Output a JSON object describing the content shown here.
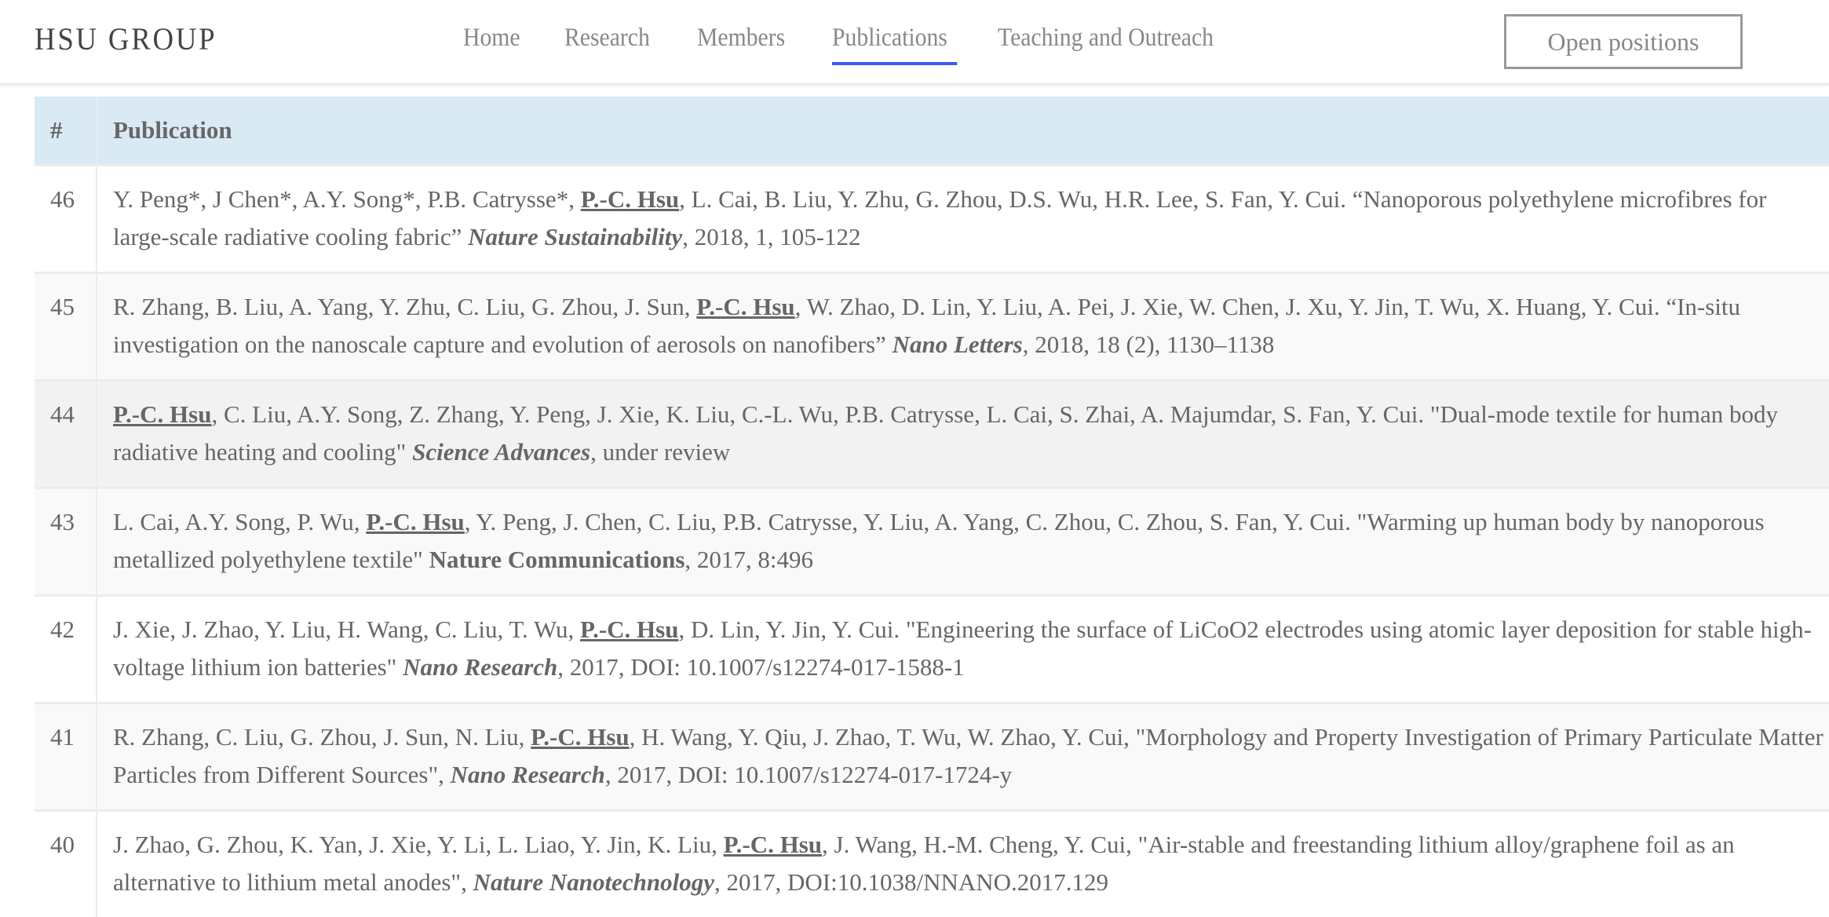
{
  "header": {
    "brand": "HSU GROUP",
    "nav": [
      {
        "label": "Home",
        "active": false
      },
      {
        "label": "Research",
        "active": false
      },
      {
        "label": "Members",
        "active": false
      },
      {
        "label": "Publications",
        "active": true
      },
      {
        "label": "Teaching and Outreach",
        "active": false
      }
    ],
    "open_positions_label": "Open positions",
    "accent_color": "#3b5bf0"
  },
  "table": {
    "columns": [
      "#",
      "Publication"
    ],
    "rows": [
      {
        "num": "46",
        "before": "Y. Peng*, J Chen*, A.Y. Song*, P.B. Catrysse*, ",
        "highlight": "P.-C. Hsu",
        "after": ", L. Cai, B. Liu, Y. Zhu, G. Zhou, D.S. Wu, H.R. Lee, S. Fan, Y. Cui. “Nanoporous polyethylene microfibres for large-scale radiative cooling fabric” ",
        "journal": "Nature Sustainability",
        "journal_italic": true,
        "tail": ", 2018, 1, 105-122"
      },
      {
        "num": "45",
        "before": "R. Zhang, B. Liu, A. Yang, Y. Zhu, C. Liu, G. Zhou, J. Sun, ",
        "highlight": "P.-C. Hsu",
        "after": ", W. Zhao, D. Lin, Y. Liu, A. Pei, J. Xie, W. Chen, J. Xu, Y. Jin, T. Wu, X. Huang, Y. Cui. “In-situ investigation on the nanoscale capture and evolution of aerosols on nanofibers” ",
        "journal": "Nano Letters",
        "journal_italic": true,
        "tail": ", 2018, 18 (2), 1130–1138"
      },
      {
        "num": "44",
        "before": "",
        "highlight": "P.-C. Hsu",
        "after": ", C. Liu, A.Y. Song, Z. Zhang, Y. Peng, J. Xie, K. Liu, C.-L. Wu, P.B. Catrysse, L. Cai, S. Zhai, A. Majumdar, S. Fan, Y. Cui. \"Dual-mode textile for human body radiative heating and cooling\" ",
        "journal": "Science Advances",
        "journal_italic": true,
        "tail": ", under review"
      },
      {
        "num": "43",
        "before": "L. Cai, A.Y. Song, P. Wu, ",
        "highlight": "P.-C. Hsu",
        "after": ", Y. Peng, J. Chen, C. Liu, P.B. Catrysse, Y. Liu, A. Yang, C. Zhou, C. Zhou, S. Fan, Y. Cui. \"Warming up human body by nanoporous metallized polyethylene textile\" ",
        "journal": "Nature Communications",
        "journal_italic": false,
        "tail": ", 2017, 8:496"
      },
      {
        "num": "42",
        "before": "J. Xie, J. Zhao, Y. Liu, H. Wang, C. Liu, T. Wu, ",
        "highlight": "P.-C. Hsu",
        "after": ", D. Lin, Y. Jin, Y. Cui. \"Engineering the surface of LiCoO2 electrodes using atomic layer deposition for stable high-voltage lithium ion batteries\" ",
        "journal": "Nano Research",
        "journal_italic": true,
        "tail": ", 2017, DOI: 10.1007/s12274-017-1588-1"
      },
      {
        "num": "41",
        "before": "R. Zhang, C. Liu, G. Zhou, J. Sun, N. Liu, ",
        "highlight": "P.-C. Hsu",
        "after": ", H. Wang, Y. Qiu, J. Zhao, T. Wu, W. Zhao, Y. Cui, \"Morphology and Property Investigation of Primary Particulate Matter Particles from Different Sources\", ",
        "journal": "Nano Research",
        "journal_italic": true,
        "tail": ", 2017, DOI: 10.1007/s12274-017-1724-y"
      },
      {
        "num": "40",
        "before": "J. Zhao, G. Zhou, K. Yan, J. Xie, Y. Li, L. Liao, Y. Jin, K. Liu, ",
        "highlight": "P.-C. Hsu",
        "after": ", J. Wang, H.-M. Cheng, Y. Cui, \"Air-stable and freestanding lithium alloy/graphene foil as an alternative to lithium metal anodes\", ",
        "journal": "Nature Nanotechnology",
        "journal_italic": true,
        "tail": ", 2017, DOI:10.1038/NNANO.2017.129"
      }
    ],
    "hovered_row": "44"
  }
}
